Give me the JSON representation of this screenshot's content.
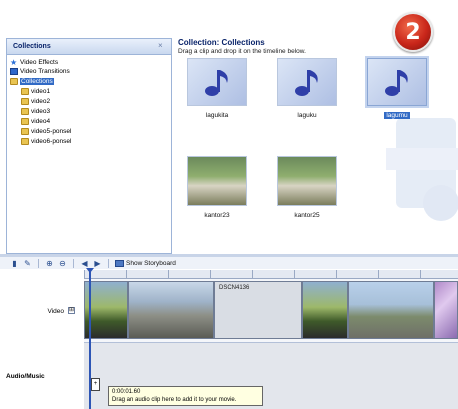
{
  "tree": {
    "title": "Collections",
    "items": [
      {
        "label": "Video Effects",
        "icon": "star-icon"
      },
      {
        "label": "Video Transitions",
        "icon": "transition-icon"
      },
      {
        "label": "Collections",
        "icon": "folder-icon",
        "selected": true
      },
      {
        "label": "video1",
        "icon": "folder-icon"
      },
      {
        "label": "video2",
        "icon": "folder-icon"
      },
      {
        "label": "video3",
        "icon": "folder-icon"
      },
      {
        "label": "video4",
        "icon": "folder-icon"
      },
      {
        "label": "video5-ponsel",
        "icon": "folder-icon"
      },
      {
        "label": "video6-ponsel",
        "icon": "folder-icon"
      }
    ]
  },
  "content": {
    "title": "Collection: Collections",
    "hint": "Drag a clip and drop it on the timeline below.",
    "clips": [
      {
        "label": "lagukita",
        "kind": "audio"
      },
      {
        "label": "laguku",
        "kind": "audio"
      },
      {
        "label": "lagumu",
        "kind": "audio",
        "selected": true
      },
      {
        "label": "kantor23",
        "kind": "photo"
      },
      {
        "label": "kantor25",
        "kind": "photo"
      }
    ]
  },
  "badge": {
    "number": "2"
  },
  "toolbar": {
    "storyboard_label": "Show Storyboard"
  },
  "timeline": {
    "video_label": "Video",
    "expand_symbol": "⊞",
    "audio_label": "Audio/Music",
    "clip_label": "DSCN4136"
  },
  "tooltip": {
    "time": "0:00:01.60",
    "message": "Drag an audio clip here to add it to your movie."
  },
  "colors": {
    "accent": "#316ac5",
    "pane_border": "#9db4d8",
    "badge": "#c9261a",
    "tooltip_bg": "#ffffe1"
  }
}
